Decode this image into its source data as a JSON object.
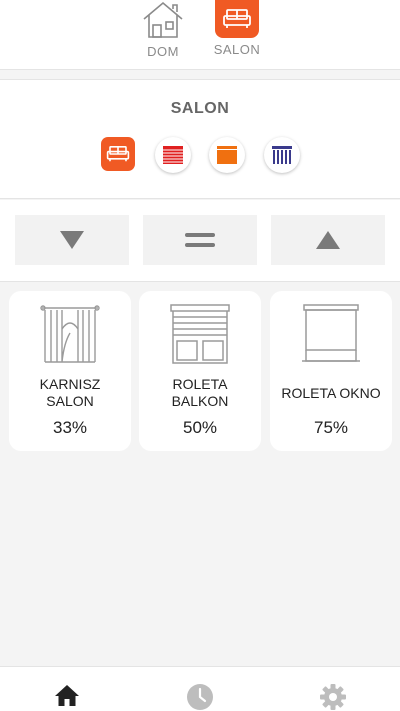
{
  "top_tabs": [
    {
      "label": "DOM",
      "icon": "house-icon",
      "active": false
    },
    {
      "label": "SALON",
      "icon": "sofa-icon",
      "active": true
    }
  ],
  "room": {
    "title": "SALON",
    "filters": [
      {
        "icon": "sofa-icon",
        "color": "#f05a24",
        "active": true
      },
      {
        "icon": "red-blind-icon",
        "color": "#e02020"
      },
      {
        "icon": "orange-blind-icon",
        "color": "#f07010"
      },
      {
        "icon": "navy-curtain-icon",
        "color": "#3a3a8c"
      }
    ]
  },
  "controls": [
    {
      "icon": "arrow-down-icon"
    },
    {
      "icon": "stop-icon"
    },
    {
      "icon": "arrow-up-icon"
    }
  ],
  "devices": [
    {
      "name": "KARNISZ SALON",
      "percent": "33%",
      "icon": "curtain-icon"
    },
    {
      "name": "ROLETA BALKON",
      "percent": "50%",
      "icon": "balcony-blind-icon"
    },
    {
      "name": "ROLETA OKNO",
      "percent": "75%",
      "icon": "window-blind-icon"
    }
  ],
  "nav": [
    {
      "icon": "home-icon",
      "active": true
    },
    {
      "icon": "clock-icon"
    },
    {
      "icon": "gear-icon"
    }
  ],
  "colors": {
    "accent": "#f05a24",
    "icon_gray": "#8a8a8a",
    "control_gray": "#7a7a7a"
  }
}
